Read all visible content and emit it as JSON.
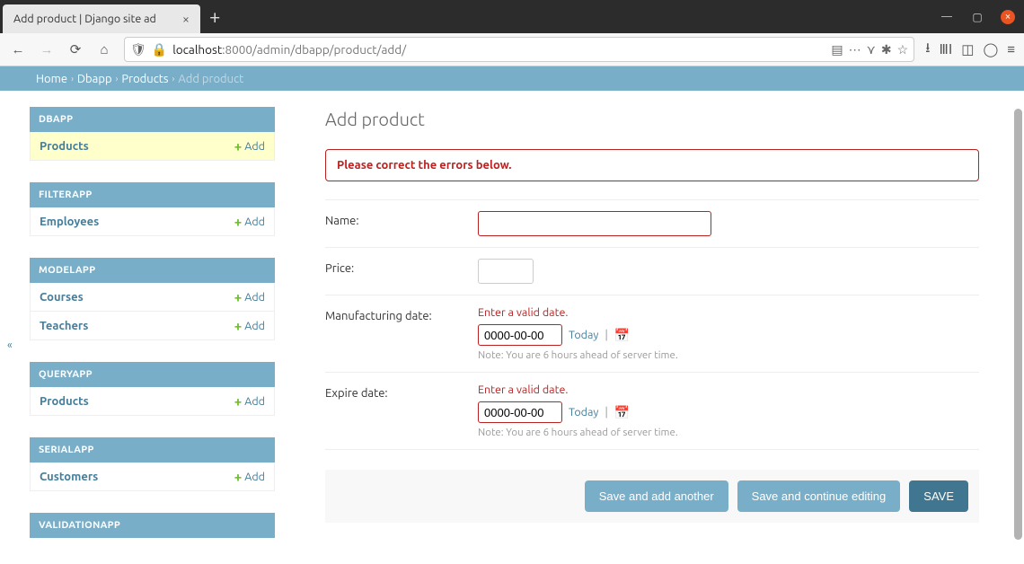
{
  "browser": {
    "tab_title": "Add product | Django site ad",
    "url_prefix": "localhost",
    "url_rest": ":8000/admin/dbapp/product/add/"
  },
  "breadcrumbs": {
    "home": "Home",
    "app": "Dbapp",
    "model": "Products",
    "current": "Add product"
  },
  "sidebar": {
    "modules": [
      {
        "title": "DBAPP",
        "rows": [
          {
            "label": "Products",
            "add": "Add",
            "selected": true
          }
        ]
      },
      {
        "title": "FILTERAPP",
        "rows": [
          {
            "label": "Employees",
            "add": "Add"
          }
        ]
      },
      {
        "title": "MODELAPP",
        "rows": [
          {
            "label": "Courses",
            "add": "Add"
          },
          {
            "label": "Teachers",
            "add": "Add"
          }
        ]
      },
      {
        "title": "QUERYAPP",
        "rows": [
          {
            "label": "Products",
            "add": "Add"
          }
        ]
      },
      {
        "title": "SERIALAPP",
        "rows": [
          {
            "label": "Customers",
            "add": "Add"
          }
        ]
      },
      {
        "title": "VALIDATIONAPP",
        "rows": []
      }
    ]
  },
  "page": {
    "title": "Add product",
    "error_banner": "Please correct the errors below.",
    "fields": {
      "name": {
        "label": "Name:"
      },
      "price": {
        "label": "Price:"
      },
      "mfg": {
        "label": "Manufacturing date:",
        "error": "Enter a valid date.",
        "value": "0000-00-00",
        "today": "Today",
        "help": "Note: You are 6 hours ahead of server time."
      },
      "exp": {
        "label": "Expire date:",
        "error": "Enter a valid date.",
        "value": "0000-00-00",
        "today": "Today",
        "help": "Note: You are 6 hours ahead of server time."
      }
    },
    "buttons": {
      "save_add_another": "Save and add another",
      "save_continue": "Save and continue editing",
      "save": "SAVE"
    }
  }
}
